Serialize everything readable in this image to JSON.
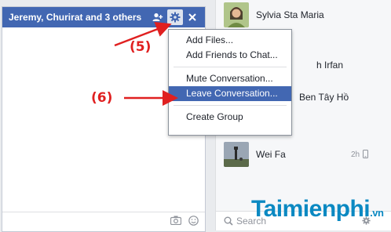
{
  "chat": {
    "title": "Jeremy, Churirat and 3 others"
  },
  "menu": {
    "items": [
      {
        "label": "Add Files..."
      },
      {
        "label": "Add Friends to Chat..."
      },
      {
        "label": "Mute Conversation..."
      },
      {
        "label": "Leave Conversation..."
      },
      {
        "label": "Create Group"
      }
    ],
    "selected_index": 3
  },
  "sidebar": {
    "contacts": [
      {
        "name": "Sylvia Sta Maria",
        "time": ""
      },
      {
        "name": "h Irfan",
        "time": ""
      },
      {
        "name": "Ben Tây Hồ",
        "time": ""
      },
      {
        "name": "Wei Fa",
        "time": "2h"
      }
    ],
    "search_placeholder": "Search"
  },
  "annotations": {
    "step5": "(5)",
    "step6": "(6)"
  },
  "watermark": {
    "main": "Taimienphi",
    "suffix": ".vn"
  },
  "colors": {
    "header": "#4267b2",
    "selected": "#4267b2",
    "annotation": "#e02020",
    "watermark": "#0b89c2"
  }
}
